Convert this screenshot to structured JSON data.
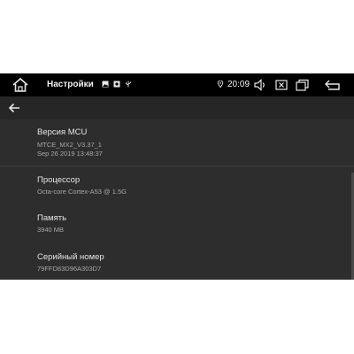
{
  "statusbar": {
    "title": "Настройки",
    "time": "20:09",
    "icons": [
      "home-icon",
      "image-icon",
      "android-icon",
      "usb-icon",
      "location-icon",
      "volume-icon",
      "close-window-icon",
      "recent-apps-icon",
      "back-nav-icon"
    ]
  },
  "actionbar": {
    "icons": [
      "back-arrow-icon"
    ]
  },
  "items": [
    {
      "title": "Версия MCU",
      "lines": [
        "MTCE_MX2_V3.37_1",
        "Sep 26 2019 13:48:37"
      ]
    },
    {
      "title": "Процессор",
      "lines": [
        "Octa-core Cortex-A53 @  1.5G"
      ]
    },
    {
      "title": "Память",
      "lines": [
        "3940 MB"
      ]
    },
    {
      "title": "Серийный номер",
      "lines": [
        "79FFD83D96A303D7"
      ]
    }
  ],
  "colors": {
    "statusbar_bg": "#000000",
    "list_bg": "#2d2d2d",
    "title_text": "#e6e6e6",
    "subtitle_text": "#a9a9a9"
  }
}
